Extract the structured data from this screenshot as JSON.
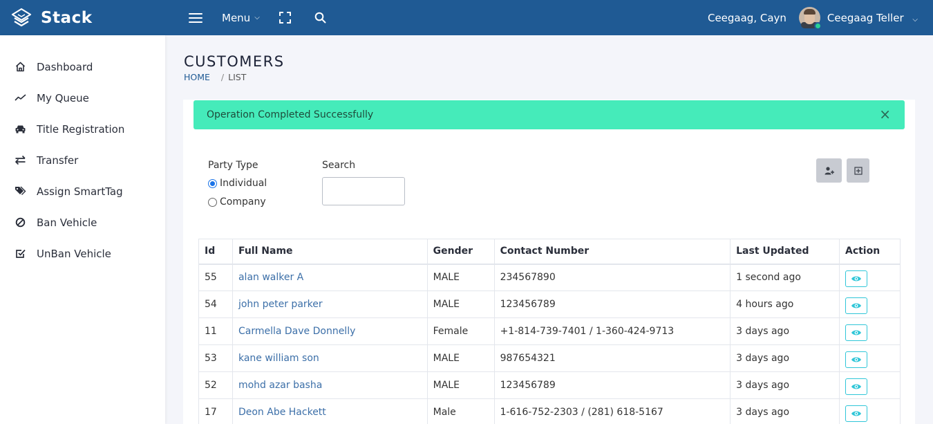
{
  "brand": {
    "name": "Stack"
  },
  "topnav": {
    "menu_label": "Menu",
    "branch": "Ceegaag, Cayn",
    "user_name": "Ceegaag Teller"
  },
  "sidebar": {
    "items": [
      {
        "label": "Dashboard",
        "icon": "home-icon"
      },
      {
        "label": "My Queue",
        "icon": "trend-line-icon"
      },
      {
        "label": "Title Registration",
        "icon": "car-icon"
      },
      {
        "label": "Transfer",
        "icon": "transfer-arrows-icon"
      },
      {
        "label": "Assign SmartTag",
        "icon": "tags-icon"
      },
      {
        "label": "Ban Vehicle",
        "icon": "ban-icon"
      },
      {
        "label": "UnBan Vehicle",
        "icon": "check-square-icon"
      }
    ]
  },
  "page": {
    "title": "CUSTOMERS",
    "breadcrumb": {
      "home": "HOME",
      "current": "LIST"
    }
  },
  "alert": {
    "message": "Operation Completed Successfully",
    "close": "×"
  },
  "filters": {
    "party_type_label": "Party Type",
    "options": [
      {
        "label": "Individual",
        "checked": true
      },
      {
        "label": "Company",
        "checked": false
      }
    ],
    "search_label": "Search",
    "search_value": "",
    "search_placeholder": ""
  },
  "toolbar": {
    "add_customer_icon": "user-plus-icon",
    "columns_icon": "grid-plus-icon"
  },
  "table": {
    "headers": [
      "Id",
      "Full Name",
      "Gender",
      "Contact Number",
      "Last Updated",
      "Action"
    ],
    "rows": [
      {
        "id": "55",
        "name": "alan walker A",
        "gender": "MALE",
        "contact": "234567890",
        "updated": "1 second ago"
      },
      {
        "id": "54",
        "name": "john peter parker",
        "gender": "MALE",
        "contact": "123456789",
        "updated": "4 hours ago"
      },
      {
        "id": "11",
        "name": "Carmella Dave Donnelly",
        "gender": "Female",
        "contact": "+1-814-739-7401 / 1-360-424-9713",
        "updated": "3 days ago"
      },
      {
        "id": "53",
        "name": "kane william son",
        "gender": "MALE",
        "contact": "987654321",
        "updated": "3 days ago"
      },
      {
        "id": "52",
        "name": "mohd azar basha",
        "gender": "MALE",
        "contact": "123456789",
        "updated": "3 days ago"
      },
      {
        "id": "17",
        "name": "Deon Abe Hackett",
        "gender": "Male",
        "contact": "1-616-752-2303 / (281) 618-5167",
        "updated": "3 days ago"
      }
    ]
  },
  "colors": {
    "navbar": "#1f5a94",
    "alert": "#45ebba",
    "link": "#3c6fa8",
    "view_button": "#2fc6d8"
  }
}
